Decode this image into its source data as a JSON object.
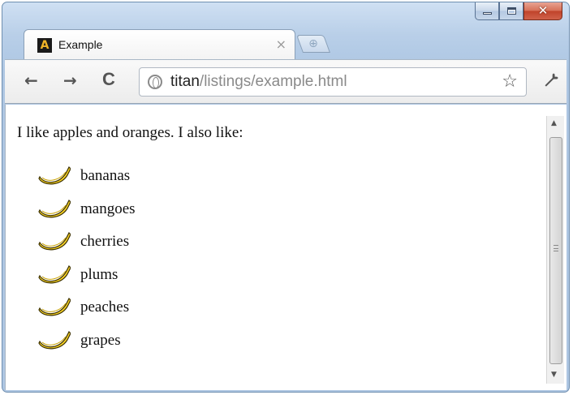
{
  "window": {
    "controls": {
      "minimize_icon": "minimize-icon",
      "maximize_icon": "maximize-icon",
      "close_label": "✕"
    }
  },
  "tab": {
    "favicon_letter": "A",
    "title": "Example",
    "close_label": "×"
  },
  "new_tab_label": "⊕",
  "toolbar": {
    "back_label": "←",
    "forward_label": "→",
    "reload_label": "C",
    "url_host": "titan",
    "url_path": "/listings/example.html",
    "star_label": "☆",
    "wrench_label": "🔧"
  },
  "page": {
    "intro": "I like apples and oranges. I also like:",
    "items": [
      "bananas",
      "mangoes",
      "cherries",
      "plums",
      "peaches",
      "grapes"
    ]
  },
  "colors": {
    "banana_fill": "#f7d226",
    "banana_outline": "#3b3000"
  }
}
